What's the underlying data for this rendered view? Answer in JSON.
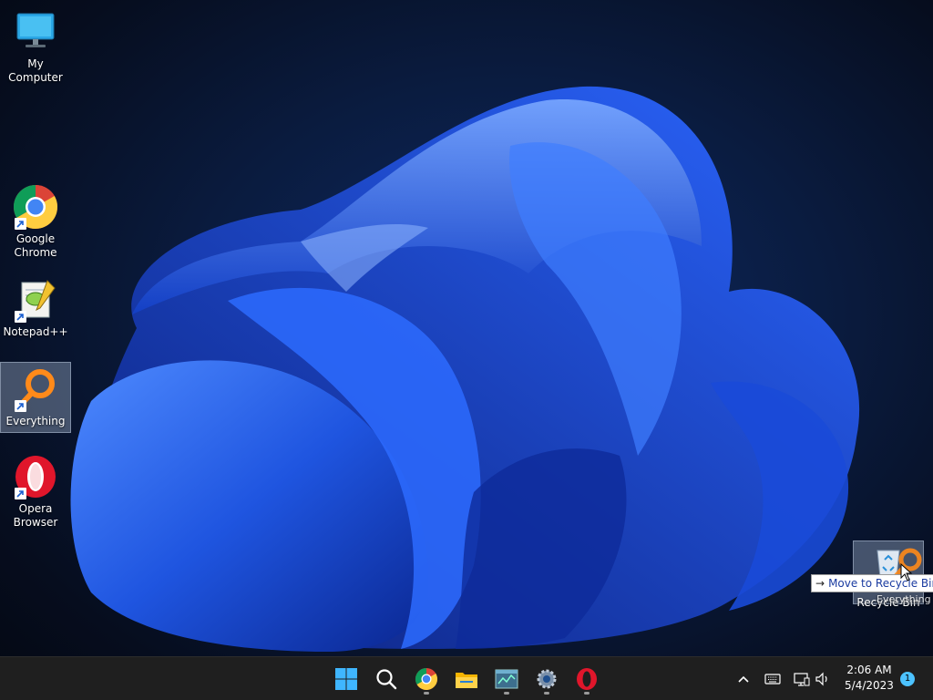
{
  "desktop": {
    "icons": [
      {
        "label": "My Computer"
      },
      {
        "label": "Google Chrome"
      },
      {
        "label": "Notepad++"
      },
      {
        "label": "Everything"
      },
      {
        "label": "Opera Browser"
      },
      {
        "label": "Recycle Bin"
      }
    ],
    "drag_ghost_label": "Everything",
    "tooltip": "Move to Recycle Bin"
  },
  "taskbar": {
    "apps": [
      "start-icon",
      "search-icon",
      "chrome-icon",
      "file-explorer-icon",
      "task-manager-icon",
      "settings-icon",
      "opera-icon"
    ],
    "tray": [
      "chevron-up-icon",
      "keyboard-icon",
      "network-icon",
      "volume-icon"
    ],
    "time": "2:06 AM",
    "date": "5/4/2023",
    "notification_count": "1"
  },
  "colors": {
    "taskbar": "#1f1f1f",
    "accent": "#4cc2ff",
    "wallpaper_blue": "#1f55e0"
  }
}
